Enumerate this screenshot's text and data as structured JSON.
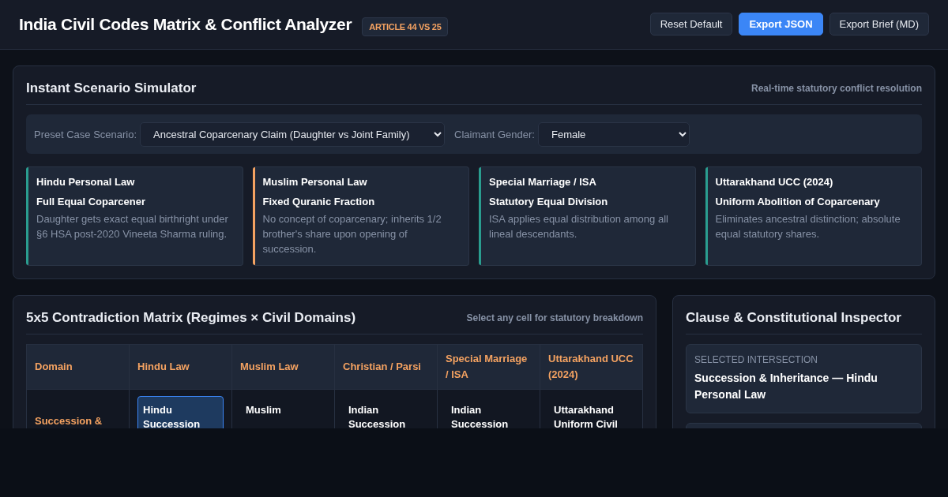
{
  "header": {
    "title": "India Civil Codes Matrix & Conflict Analyzer",
    "badge": "ARTICLE 44 VS 25",
    "buttons": [
      {
        "label": "Reset Default",
        "kind": "secondary"
      },
      {
        "label": "Export JSON",
        "kind": "primary"
      },
      {
        "label": "Export Brief (MD)",
        "kind": "secondary"
      }
    ]
  },
  "simulator": {
    "title": "Instant Scenario Simulator",
    "subtitle": "Real-time statutory conflict resolution",
    "controls": [
      {
        "label": "Preset Case Scenario:",
        "value": "Ancestral Coparcenary Claim (Daughter vs Joint Family)"
      },
      {
        "label": "Claimant Gender:",
        "value": "Female"
      }
    ],
    "outcomes": [
      {
        "regime": "Hindu Personal Law",
        "verdict": "Full Equal Coparcener",
        "detail": "Daughter gets exact equal birthright under §6 HSA post-2020 Vineeta Sharma ruling.",
        "color": "#2a9d8f"
      },
      {
        "regime": "Muslim Personal Law",
        "verdict": "Fixed Quranic Fraction",
        "detail": "No concept of coparcenary; inherits 1/2 brother's share upon opening of succession.",
        "color": "#f4a261"
      },
      {
        "regime": "Special Marriage / ISA",
        "verdict": "Statutory Equal Division",
        "detail": "ISA applies equal distribution among all lineal descendants.",
        "color": "#2a9d8f"
      },
      {
        "regime": "Uttarakhand UCC (2024)",
        "verdict": "Uniform Abolition of Coparcenary",
        "detail": "Eliminates ancestral distinction; absolute equal statutory shares.",
        "color": "#2a9d8f"
      }
    ]
  },
  "matrix": {
    "title": "5x5 Contradiction Matrix (Regimes × Civil Domains)",
    "hint": "Select any cell for statutory breakdown",
    "columns": [
      "Domain",
      "Hindu Law",
      "Muslim Law",
      "Christian / Parsi",
      "Special Marriage / ISA",
      "Uttarakhand UCC (2024)"
    ],
    "rows": [
      {
        "cells": [
          {
            "text": "Succession &",
            "kind": "domain",
            "selected": false
          },
          {
            "text": "Hindu Succession",
            "kind": "entry",
            "selected": true
          },
          {
            "text": "Muslim",
            "kind": "entry",
            "selected": false
          },
          {
            "text": "Indian Succession",
            "kind": "entry",
            "selected": false
          },
          {
            "text": "Indian Succession",
            "kind": "entry",
            "selected": false
          },
          {
            "text": "Uttarakhand Uniform Civil",
            "kind": "entry",
            "selected": false
          }
        ]
      }
    ]
  },
  "inspector": {
    "title": "Clause & Constitutional Inspector",
    "label": "SELECTED INTERSECTION",
    "value": "Succession & Inheritance — Hindu Personal Law"
  }
}
